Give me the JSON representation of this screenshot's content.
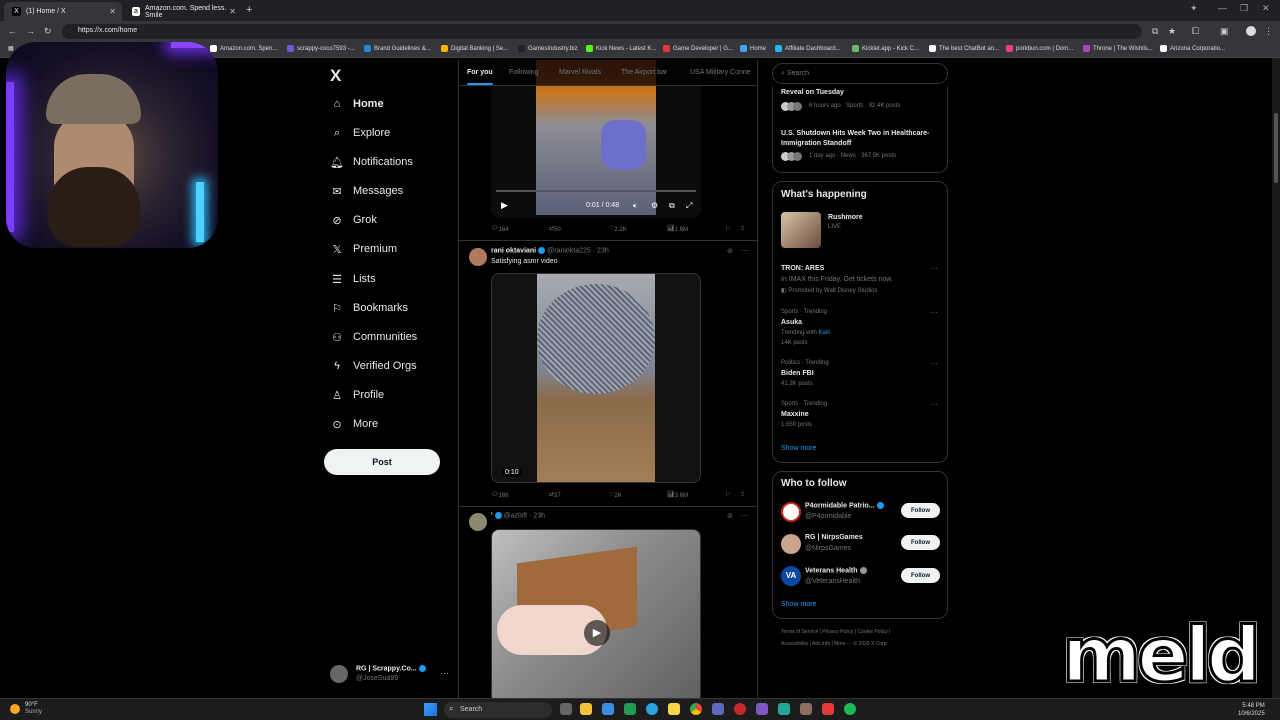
{
  "browser": {
    "tabs": [
      {
        "label": "(1) Home / X",
        "favicon": "X",
        "active": true
      },
      {
        "label": "Amazon.com. Spend less. Smile",
        "favicon": "a",
        "active": false
      }
    ],
    "url": "https://x.com/home",
    "bookmarks": [
      "M",
      "Amazon.com. Spen...",
      "scrappy-coco7593 -...",
      "Brand Guidelines &...",
      "Digital Banking | Se...",
      "GamesIndustry.biz",
      "Kick News - Latest K...",
      "Game Developer | G...",
      "Home",
      "Affiliate Dashboard...",
      "Kicklet.app - Kick C...",
      "The best ChatBot an...",
      "porkbun.com | Dom...",
      "Throne | The Wishlis...",
      "Arizona Corporatio..."
    ]
  },
  "nav": {
    "logo": "X",
    "items": [
      {
        "label": "Home",
        "icon": "home-icon",
        "glyph": "⌂"
      },
      {
        "label": "Explore",
        "icon": "search-icon",
        "glyph": "⌕"
      },
      {
        "label": "Notifications",
        "icon": "bell-icon",
        "glyph": "🔔︎"
      },
      {
        "label": "Messages",
        "icon": "envelope-icon",
        "glyph": "✉"
      },
      {
        "label": "Grok",
        "icon": "grok-icon",
        "glyph": "⊘"
      },
      {
        "label": "Premium",
        "icon": "x-premium-icon",
        "glyph": "𝕏"
      },
      {
        "label": "Lists",
        "icon": "list-icon",
        "glyph": "☰"
      },
      {
        "label": "Bookmarks",
        "icon": "bookmark-icon",
        "glyph": "⚐"
      },
      {
        "label": "Communities",
        "icon": "people-icon",
        "glyph": "⚇"
      },
      {
        "label": "Verified Orgs",
        "icon": "lightning-icon",
        "glyph": "ϟ"
      },
      {
        "label": "Profile",
        "icon": "person-icon",
        "glyph": "♙"
      },
      {
        "label": "More",
        "icon": "more-circle-icon",
        "glyph": "⊙"
      }
    ],
    "post_label": "Post",
    "account_name": "RG | Scrappy.Co...",
    "account_handle": "@JoseSua99"
  },
  "feed": {
    "tabs": [
      "For you",
      "Following",
      "Marvel Rivals",
      "The Airport bar",
      "USA Military Conne"
    ],
    "tweet1": {
      "video_time": "0:01 / 0:48",
      "replies": "164",
      "reposts": "50",
      "likes": "2.2K",
      "views": "1.6M"
    },
    "tweet2": {
      "name": "rani oktaviani",
      "handle": "@raniokta225 · 23h",
      "text": "Satisfying asmr video",
      "duration": "0:10",
      "replies": "166",
      "reposts": "37",
      "likes": "2K",
      "views": "3.6M"
    },
    "tweet3": {
      "name": "'",
      "handle": "@azlsft · 23h"
    }
  },
  "right": {
    "search_placeholder": "Search",
    "top_panel": {
      "item1_title": "Reveal on Tuesday",
      "item1_meta": "6 hours ago · Sports · 92.4K posts",
      "item2_title": "U.S. Shutdown Hits Week Two in Healthcare-Immigration Standoff",
      "item2_meta": "1 day ago · News · 367.5K posts"
    },
    "whats_happening": {
      "title": "What's happening",
      "live_title": "Rushmore",
      "live_label": "LIVE",
      "promo_title": "TRON: ARES",
      "promo_text": "In IMAX this Friday. Get tickets now.",
      "promo_by": "Promoted by Walt Disney Studios",
      "trends": [
        {
          "context": "Sports · Trending",
          "name": "Asuka",
          "meta_prefix": "Trending with ",
          "meta_link": "Kairi",
          "posts": "14K posts"
        },
        {
          "context": "Politics · Trending",
          "name": "Biden FBI",
          "posts": "41.2K posts"
        },
        {
          "context": "Sports · Trending",
          "name": "Maxxine",
          "posts": "1,659 posts"
        }
      ],
      "show_more": "Show more"
    },
    "who_to_follow": {
      "title": "Who to follow",
      "accounts": [
        {
          "name": "P4ormidable Patrio...",
          "handle": "@P4ormidable"
        },
        {
          "name": "RG | NirpsGames",
          "handle": "@NirpsGames"
        },
        {
          "name": "Veterans Health",
          "handle": "@VeteransHealth"
        }
      ],
      "follow_label": "Follow",
      "show_more": "Show more"
    },
    "footer_line1": "Terms of Service  |  Privacy Policy  |  Cookie Policy  |",
    "footer_line2": "Accessibility  |  Ads info  |  More ···  © 2025 X Corp."
  },
  "overlay": {
    "brand": "meld"
  },
  "taskbar": {
    "temp": "90°F",
    "weather": "Sunny",
    "search": "Search",
    "time": "5:48 PM",
    "date": "10/6/2025"
  }
}
